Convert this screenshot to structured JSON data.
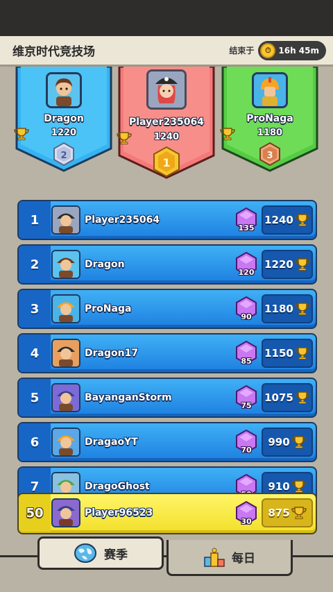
{
  "header": {
    "title": "维京时代竞技场",
    "timer_label": "结束于",
    "timer_value": "16h 45m"
  },
  "podium": [
    {
      "place": "2",
      "name": "Dragon",
      "score": "1220",
      "color": "#35b3f2"
    },
    {
      "place": "1",
      "name": "Player235064",
      "score": "1240",
      "color": "#f47a7a"
    },
    {
      "place": "3",
      "name": "ProNaga",
      "score": "1180",
      "color": "#63d84e"
    }
  ],
  "rows": [
    {
      "rank": "1",
      "name": "Player235064",
      "gems": "135",
      "score": "1240"
    },
    {
      "rank": "2",
      "name": "Dragon",
      "gems": "120",
      "score": "1220"
    },
    {
      "rank": "3",
      "name": "ProNaga",
      "gems": "90",
      "score": "1180"
    },
    {
      "rank": "4",
      "name": "Dragon17",
      "gems": "85",
      "score": "1150"
    },
    {
      "rank": "5",
      "name": "BayanganStorm",
      "gems": "75",
      "score": "1075"
    },
    {
      "rank": "6",
      "name": "DragaoYT",
      "gems": "70",
      "score": "990"
    },
    {
      "rank": "7",
      "name": "DragoGhost",
      "gems": "50",
      "score": "910"
    }
  ],
  "me": {
    "rank": "50",
    "name": "Player96523",
    "gems": "30",
    "score": "875"
  },
  "tabs": {
    "season": "赛季",
    "daily": "每日"
  },
  "icons": {
    "trophy": "trophy-icon",
    "gem": "gem-icon",
    "clock": "clock-icon",
    "globe": "globe-icon",
    "podium": "podium-icon"
  }
}
